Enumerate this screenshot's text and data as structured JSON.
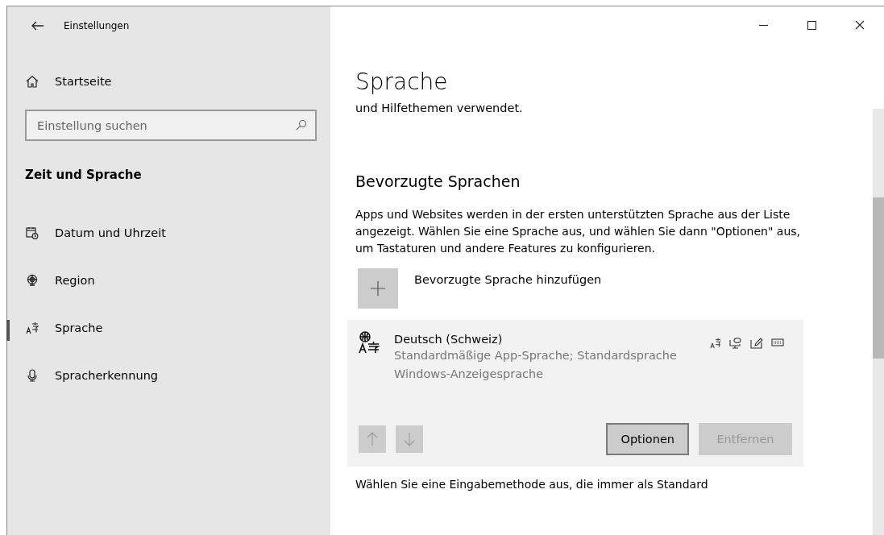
{
  "window": {
    "title": "Einstellungen"
  },
  "sidebar": {
    "home": "Startseite",
    "search": {
      "placeholder": "Einstellung suchen"
    },
    "section": "Zeit und Sprache",
    "items": [
      {
        "kind": "calendar",
        "label": "Datum und Uhrzeit",
        "selected": false
      },
      {
        "kind": "globe",
        "label": "Region",
        "selected": false
      },
      {
        "kind": "language",
        "label": "Sprache",
        "selected": true
      },
      {
        "kind": "mic",
        "label": "Spracherkennung",
        "selected": false
      }
    ]
  },
  "page": {
    "title": "Sprache",
    "intro_tail": "und Hilfethemen verwendet.",
    "section": "Bevorzugte Sprachen",
    "description": "Apps und Websites werden in der ersten unterstützten Sprache aus der Liste angezeigt. Wählen Sie eine Sprache aus, und wählen Sie dann \"Optionen\" aus, um Tastaturen und andere Features zu konfigurieren.",
    "add_label": "Bevorzugte Sprache hinzufügen",
    "languages": [
      {
        "name": "Deutsch (Schweiz)",
        "details": "Standardmäßige App-Sprache; Standardsprache Windows-Anzeigesprache",
        "move_up": {
          "disabled": true
        },
        "move_down": {
          "disabled": true
        },
        "buttons": [
          {
            "label": "Optionen",
            "disabled": false
          },
          {
            "label": "Entfernen",
            "disabled": true
          }
        ]
      }
    ],
    "footer": "Wählen Sie eine Eingabemethode aus, die immer als Standard"
  }
}
